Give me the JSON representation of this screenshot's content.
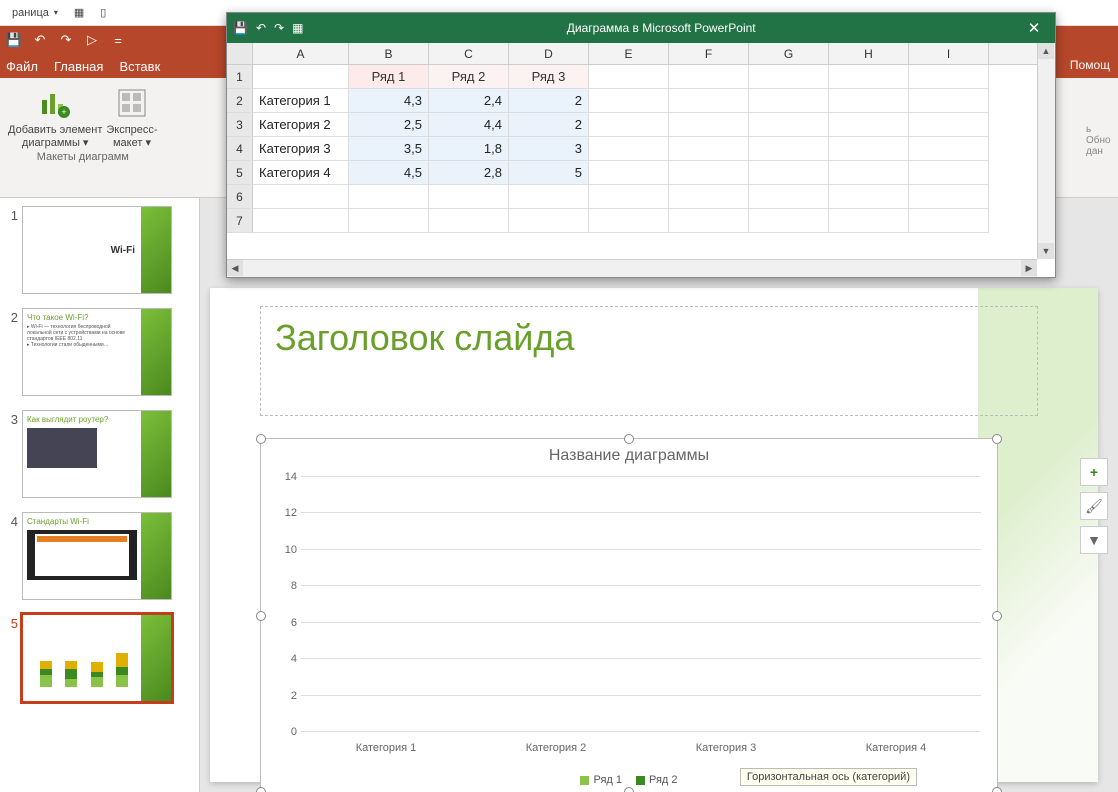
{
  "topbar": {
    "item_page": "раница",
    "dd_char": "▾"
  },
  "qat": {
    "save": "💾",
    "undo": "↶",
    "redo": "↷",
    "start": "▷",
    "more": "⋯"
  },
  "tabs": {
    "file": "Файл",
    "home": "Главная",
    "insert": "Вставк",
    "help": "Помощ"
  },
  "ribbon": {
    "add_elem_l1": "Добавить элемент",
    "add_elem_l2": "диаграммы",
    "express_l1": "Экспресс-",
    "express_l2": "макет",
    "group_caption": "Макеты диаграмм",
    "right_l1": "ь  Обно",
    "right_l2": "    дан"
  },
  "excel": {
    "title": "Диаграмма в Microsoft PowerPoint",
    "close": "✕",
    "cols": [
      "A",
      "B",
      "C",
      "D",
      "E",
      "F",
      "G",
      "H",
      "I"
    ],
    "row_nums": [
      "1",
      "2",
      "3",
      "4",
      "5",
      "6",
      "7"
    ],
    "header_row": [
      "",
      "Ряд 1",
      "Ряд 2",
      "Ряд 3"
    ],
    "rows": [
      [
        "Категория 1",
        "4,3",
        "2,4",
        "2"
      ],
      [
        "Категория 2",
        "2,5",
        "4,4",
        "2"
      ],
      [
        "Категория 3",
        "3,5",
        "1,8",
        "3"
      ],
      [
        "Категория 4",
        "4,5",
        "2,8",
        "5"
      ]
    ]
  },
  "thumbs": {
    "t1": {
      "num": "1",
      "title": "Wi-Fi"
    },
    "t2": {
      "num": "2",
      "title": "Что такое  Wi-Fi?"
    },
    "t3": {
      "num": "3",
      "title": "Как выглядит роутер?"
    },
    "t4": {
      "num": "4",
      "title": "Стандарты  Wi-Fi"
    },
    "t5": {
      "num": "5",
      "title": ""
    }
  },
  "slide": {
    "title_placeholder": "Заголовок слайда"
  },
  "chart_data": {
    "type": "bar",
    "stacked": true,
    "title": "Название диаграммы",
    "categories": [
      "Категория 1",
      "Категория 2",
      "Категория 3",
      "Категория 4"
    ],
    "series": [
      {
        "name": "Ряд 1",
        "values": [
          4.3,
          2.5,
          3.5,
          4.5
        ],
        "color": "#8bc34a"
      },
      {
        "name": "Ряд 2",
        "values": [
          2.4,
          4.4,
          1.8,
          2.8
        ],
        "color": "#3a8a1f"
      },
      {
        "name": "Ряд 3",
        "values": [
          2,
          2,
          3,
          5
        ],
        "color": "#e0b000"
      }
    ],
    "ylim": [
      0,
      14
    ],
    "yticks": [
      0,
      2,
      4,
      6,
      8,
      10,
      12,
      14
    ],
    "legend_labels": [
      "Ряд 1",
      "Ряд 2"
    ],
    "tooltip": "Горизонтальная ось (категорий)"
  },
  "flyout": {
    "plus": "+",
    "brush": "🖌",
    "filter": "⧩"
  }
}
